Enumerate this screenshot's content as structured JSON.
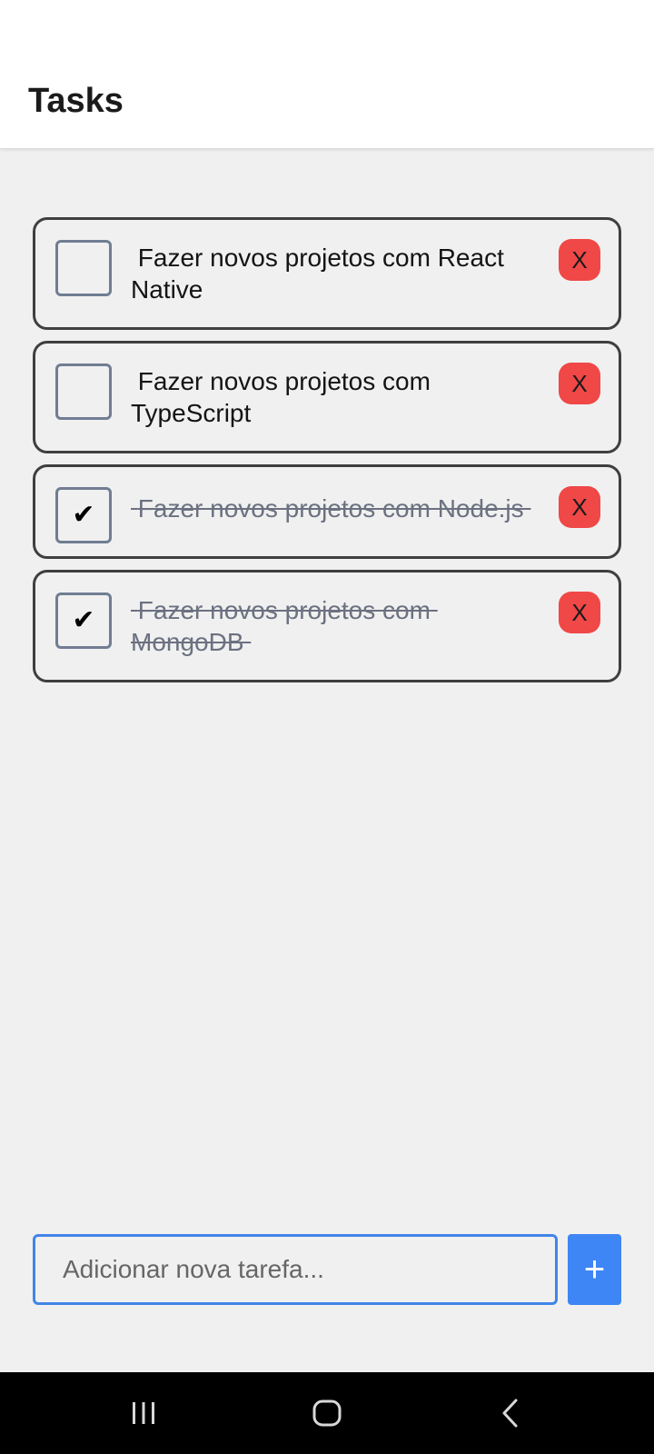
{
  "header": {
    "title": "Tasks"
  },
  "tasks": [
    {
      "text": " Fazer novos projetos com React Native",
      "done": false,
      "delete_label": "X"
    },
    {
      "text": " Fazer novos projetos com TypeScript",
      "done": false,
      "delete_label": "X"
    },
    {
      "text": " Fazer novos projetos com Node.js ",
      "done": true,
      "delete_label": "X"
    },
    {
      "text": " Fazer novos projetos com MongoDB ",
      "done": true,
      "delete_label": "X"
    }
  ],
  "input": {
    "placeholder": "Adicionar nova tarefa...",
    "value": ""
  },
  "add_button": {
    "label": "+"
  },
  "colors": {
    "accent": "#3e86f5",
    "delete": "#f04747",
    "border": "#3f3f3f",
    "checkbox_border": "#707d93"
  },
  "nav": {
    "recent_icon": "recent-apps-icon",
    "home_icon": "home-icon",
    "back_icon": "back-icon"
  }
}
